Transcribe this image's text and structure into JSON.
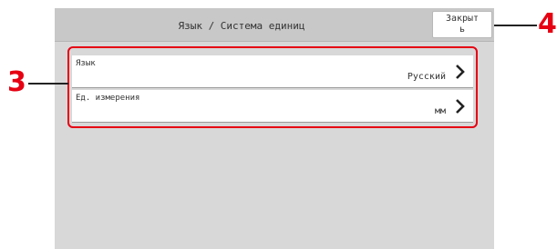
{
  "header": {
    "title": "Язык / Система единиц",
    "close_label": "Закрыт\nь"
  },
  "settings_list": {
    "items": [
      {
        "label": "Язык",
        "value": "Русский",
        "icon": "chevron-right-icon"
      },
      {
        "label": "Ед. измерения",
        "value": "мм",
        "icon": "chevron-right-icon"
      }
    ]
  },
  "callouts": {
    "list_marker": "3",
    "close_marker": "4"
  },
  "colors": {
    "accent": "#e60012",
    "panel_bg": "#d8d8d8",
    "topbar_bg": "#c8c8c8"
  }
}
